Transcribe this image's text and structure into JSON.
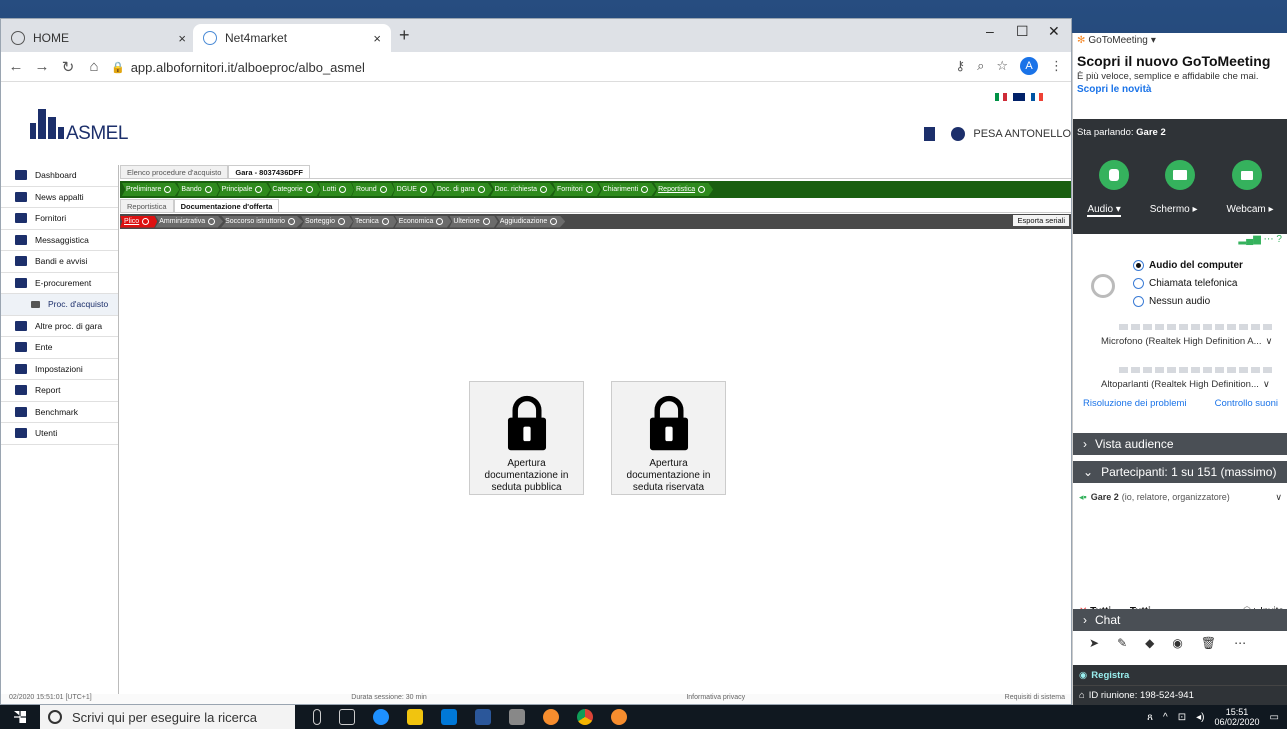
{
  "browser": {
    "tabs": [
      {
        "label": "HOME",
        "close": "×"
      },
      {
        "label": "Net4market",
        "close": "×"
      }
    ],
    "new_tab": "+",
    "url": "app.albofornitori.it/alboeproc/albo_asmel",
    "profile_initial": "A",
    "window_controls": {
      "minimize": "–",
      "maximize": "☐",
      "close": "✕"
    }
  },
  "site": {
    "logo_text": "ASMEL",
    "user_name": "PESA ANTONELLO",
    "sidebar": [
      {
        "label": "Dashboard",
        "icon": "home-icon"
      },
      {
        "label": "News appalti",
        "icon": "news-icon"
      },
      {
        "label": "Fornitori",
        "icon": "truck-icon"
      },
      {
        "label": "Messaggistica",
        "icon": "at-icon"
      },
      {
        "label": "Bandi e avvisi",
        "icon": "megaphone-icon"
      },
      {
        "label": "E-procurement",
        "icon": "cart-icon"
      },
      {
        "label": "Proc. d'acquisto",
        "icon": "list-icon",
        "sub": true
      },
      {
        "label": "Altre proc. di gara",
        "icon": "stack-icon"
      },
      {
        "label": "Ente",
        "icon": "people-icon"
      },
      {
        "label": "Impostazioni",
        "icon": "gear-icon"
      },
      {
        "label": "Report",
        "icon": "chart-icon"
      },
      {
        "label": "Benchmark",
        "icon": "doc-icon"
      },
      {
        "label": "Utenti",
        "icon": "user-icon"
      }
    ],
    "top_tabs": [
      "Elenco procedure d'acquisto",
      "Gara - 8037436DFF"
    ],
    "steps": [
      "Preliminare",
      "Bando",
      "Principale",
      "Categorie",
      "Lotti",
      "Round",
      "DGUE",
      "Doc. di gara",
      "Doc. richiesta",
      "Fornitori",
      "Chiarimenti",
      "Reportistica"
    ],
    "sub_tabs": [
      "Reportistica",
      "Documentazione d'offerta"
    ],
    "sub_steps": [
      "Plico",
      "Amministrativa",
      "Soccorso istruttorio",
      "Sorteggio",
      "Tecnica",
      "Economica",
      "Ulteriore",
      "Aggiudicazione"
    ],
    "export_label": "Esporta seriali",
    "cards": [
      {
        "label": "Apertura documentazione in seduta pubblica"
      },
      {
        "label": "Apertura documentazione in seduta riservata"
      }
    ],
    "status_left": "02/2020 15:51:01 [UTC+1]",
    "status_mid": "Durata sessione: 30 min",
    "status_mid2": "Informativa privacy",
    "status_right": "Requisiti di sistema"
  },
  "gtm": {
    "app_name": "GoToMeeting",
    "promo_title": "Scopri il nuovo GoToMeeting",
    "promo_sub": "È più veloce, semplice e affidabile che mai.",
    "promo_link": "Scopri le novità",
    "speaking_label": "Sta parlando:",
    "speaking_name": "Gare 2",
    "tabs": [
      "Audio",
      "Schermo",
      "Webcam"
    ],
    "audio_options": [
      "Audio del computer",
      "Chiamata telefonica",
      "Nessun audio"
    ],
    "mic_device": "Microfono (Realtek High Definition A...",
    "speaker_device": "Altoparlanti (Realtek High Definition...",
    "link_troubleshoot": "Risoluzione dei problemi",
    "link_sound": "Controllo suoni",
    "section_audience": "Vista audience",
    "section_participants": "Partecipanti: 1 su 151 (massimo)",
    "participant_name": "Gare 2",
    "participant_role": "(io, relatore, organizzatore)",
    "mute_all": "Tutti",
    "unmute_all": "Tutti",
    "invite": "Invita",
    "section_chat": "Chat",
    "record": "Registra",
    "meeting_id": "ID riunione: 198-524-941"
  },
  "taskbar": {
    "search_placeholder": "Scrivi qui per eseguire la ricerca",
    "time": "15:51",
    "date": "06/02/2020"
  }
}
